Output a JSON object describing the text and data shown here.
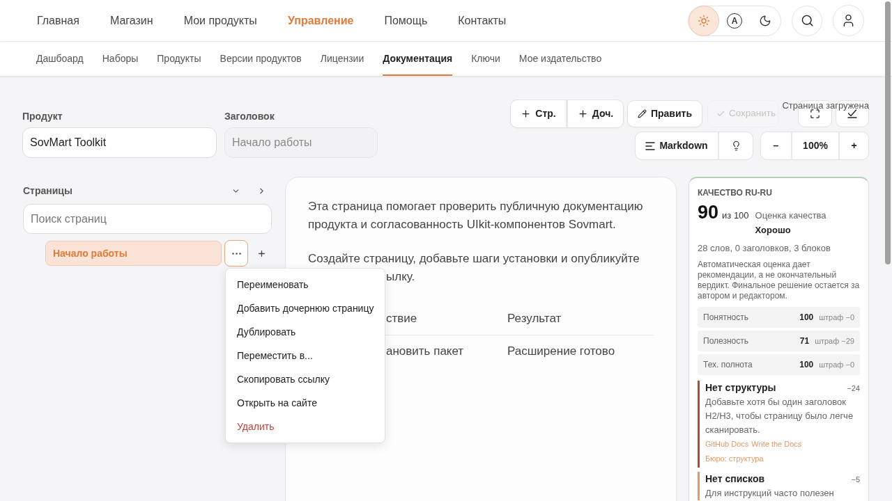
{
  "top_nav": {
    "items": [
      {
        "label": "Главная",
        "selected": false
      },
      {
        "label": "Магазин",
        "selected": false
      },
      {
        "label": "Мои продукты",
        "selected": false
      },
      {
        "label": "Управление",
        "selected": true
      },
      {
        "label": "Помощь",
        "selected": false
      },
      {
        "label": "Контакты",
        "selected": false
      }
    ],
    "theme_options": [
      {
        "kind": "light",
        "selected": true
      },
      {
        "kind": "auto",
        "label": "A",
        "selected": false
      },
      {
        "kind": "dark",
        "selected": false
      }
    ]
  },
  "sub_nav": {
    "items": [
      {
        "label": "Дашбоард",
        "selected": false
      },
      {
        "label": "Наборы",
        "selected": false
      },
      {
        "label": "Продукты",
        "selected": false
      },
      {
        "label": "Версии продуктов",
        "selected": false
      },
      {
        "label": "Лицензии",
        "selected": false
      },
      {
        "label": "Документация",
        "selected": true
      },
      {
        "label": "Ключи",
        "selected": false
      },
      {
        "label": "Мое издательство",
        "selected": false
      }
    ]
  },
  "form": {
    "product": {
      "label": "Продукт",
      "value": "SovMart Toolkit"
    },
    "title": {
      "label": "Заголовок",
      "placeholder": "Начало работы"
    }
  },
  "toolbar": {
    "add_buttons": [
      {
        "label": "Стр."
      },
      {
        "label": "Доч."
      }
    ],
    "edit_button": {
      "label": "Править"
    },
    "save_button": {
      "label": "Сохранить",
      "disabled": true
    },
    "status": "Страница загружена",
    "format_button": {
      "label": "Markdown"
    },
    "zoom": {
      "decrease": "–",
      "value": "100%",
      "increase": "+"
    }
  },
  "pages": {
    "title": "Страницы",
    "search": {
      "placeholder": "Поиск страниц"
    },
    "tree": [
      {
        "label": "Начало работы",
        "selected": true,
        "menu_open": true
      }
    ]
  },
  "context_menu": {
    "items": [
      {
        "label": "Переименовать",
        "kind": "normal"
      },
      {
        "label": "Добавить дочернюю страницу",
        "kind": "normal"
      },
      {
        "label": "Дублировать",
        "kind": "normal"
      },
      {
        "label": "Переместить в...",
        "kind": "normal"
      },
      {
        "label": "Скопировать ссылку",
        "kind": "normal"
      },
      {
        "label": "Открыть на сайте",
        "kind": "normal"
      },
      {
        "label": "Удалить",
        "kind": "danger"
      }
    ]
  },
  "document": {
    "paragraphs": [
      {
        "text": "Эта страница помогает проверить публичную документацию продукта и согласованность UIkit-компонентов Sovmart."
      },
      {
        "text": "Создайте страницу, добавьте шаги установки и опубликуйте",
        "after_menu": "ылку."
      }
    ],
    "table": {
      "columns": [
        "ствие",
        "Результат"
      ],
      "rows": [
        [
          "ановить пакет",
          "Расширение готово"
        ]
      ]
    }
  },
  "quality": {
    "title": "КАЧЕСТВО RU-RU",
    "score": "90",
    "out_of": "из 100",
    "score_label": "Оценка качества",
    "verdict": "Хорошо",
    "stats": "28 слов, 0 заголовков, 3 блоков",
    "disclaimer": "Автоматическая оценка дает рекомендации, а не окончательный вердикт. Финальное решение остается за автором и редактором.",
    "metrics": [
      {
        "name": "Понятность",
        "value": "100",
        "penalty": "штраф −0"
      },
      {
        "name": "Полезность",
        "value": "71",
        "penalty": "штраф −29"
      },
      {
        "name": "Тех. полнота",
        "value": "100",
        "penalty": "штраф −0"
      }
    ],
    "issues": [
      {
        "title": "Нет структуры",
        "penalty": "−24",
        "color": "#a84b38",
        "text": "Добавьте хотя бы один заголовок H2/H3, чтобы страницу было легче сканировать.",
        "links": [
          "GitHub Docs",
          "Write the Docs",
          "Бюро: структура"
        ]
      },
      {
        "title": "Нет списков",
        "penalty": "−5",
        "color": "#e39a62",
        "text": "Для инструкций часто полезен"
      }
    ]
  }
}
